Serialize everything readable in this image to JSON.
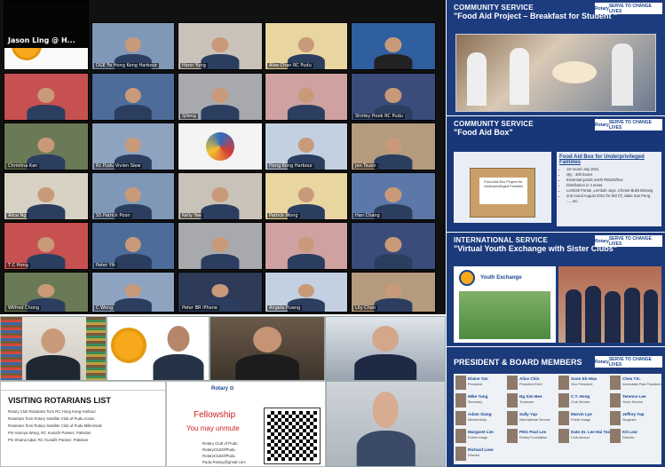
{
  "zoom_gallery": {
    "tiles": [
      {
        "name": "",
        "kind": "rotary"
      },
      {
        "name": "DGE Fe Hong Kong Harbour",
        "kind": "person"
      },
      {
        "name": "Hann Yung",
        "kind": "person"
      },
      {
        "name": "Aloe Chan RC Pudu",
        "kind": "person"
      },
      {
        "name": "",
        "kind": "slide"
      },
      {
        "name": "",
        "kind": "person"
      },
      {
        "name": "",
        "kind": "person"
      },
      {
        "name": "Sjfeng",
        "kind": "person"
      },
      {
        "name": "",
        "kind": "person"
      },
      {
        "name": "Shirley Hook RC Pudu",
        "kind": "person"
      },
      {
        "name": "Christina Kan",
        "kind": "person"
      },
      {
        "name": "Rc Pudu Vivien Siew",
        "kind": "person"
      },
      {
        "name": "",
        "kind": "logo"
      },
      {
        "name": "Hong Kong Harbour",
        "kind": "person"
      },
      {
        "name": "Jen Tsuen",
        "kind": "person"
      },
      {
        "name": "Alice Ng",
        "kind": "person"
      },
      {
        "name": "SS Patrick Poon",
        "kind": "person"
      },
      {
        "name": "Kelly Yee",
        "kind": "person"
      },
      {
        "name": "Patrick Wong",
        "kind": "person"
      },
      {
        "name": "Han Chang",
        "kind": "person"
      },
      {
        "name": "T C Hong",
        "kind": "person"
      },
      {
        "name": "Peter Yih",
        "kind": "person"
      },
      {
        "name": "",
        "kind": "person"
      },
      {
        "name": "",
        "kind": "person"
      },
      {
        "name": "",
        "kind": "person"
      },
      {
        "name": "Wilfred Chong",
        "kind": "person"
      },
      {
        "name": "C Wong",
        "kind": "person"
      },
      {
        "name": "Peter BR iPhone",
        "kind": "person"
      },
      {
        "name": "Angela Huang",
        "kind": "person"
      },
      {
        "name": "Lily Chan",
        "kind": "person"
      },
      {
        "name": "Jason Ling @ H...",
        "kind": "dark"
      }
    ]
  },
  "slides": {
    "community1": {
      "title1": "COMMUNITY SERVICE",
      "title2": "\"Food Aid Project – Breakfast for Student \""
    },
    "community2": {
      "title1": "COMMUNITY SERVICE",
      "title2": "\"Food Aid Box\"",
      "box_heading": "Food Aid Box for Underprivileged Families",
      "bullets": [
        "1st round July 2021",
        "Qty : 300 boxes",
        "Essential goods worth RM100/box",
        "Distribution in 4 areas",
        "Lembah Pantai ,Lembah Jaya ,Cheras Bukit Bintang",
        "2nd round August 2021 for SM (T) Jalan San Peng ......etc."
      ],
      "box_label": "Food Aid Box Project for Underprivileged Families"
    },
    "international": {
      "title1": "INTERNATIONAL SERVICE",
      "title2": "\"Virtual Youth Exchange with Sister Clubs\"",
      "youth": "Youth Exchange"
    },
    "board": {
      "title": "PRESIDENT & BOARD MEMBERS",
      "members": [
        {
          "name": "Elaine Tan",
          "role": "President"
        },
        {
          "name": "Alice Chin",
          "role": "President Elect"
        },
        {
          "name": "Soon Ek Hwa",
          "role": "Vice President"
        },
        {
          "name": "Chea T.K.",
          "role": "Immediate Past President"
        },
        {
          "name": "Mike Tung",
          "role": "Secretary"
        },
        {
          "name": "Ng Sim Bee",
          "role": "Treasurer"
        },
        {
          "name": "C.T. Hong",
          "role": "Club Service"
        },
        {
          "name": "Terence Lee",
          "role": "Youth Service"
        },
        {
          "name": "Adam Siang",
          "role": "Membership"
        },
        {
          "name": "Sally Yap",
          "role": "International Service"
        },
        {
          "name": "Marvin Lye",
          "role": "Public Image"
        },
        {
          "name": "Jeffrey Yap",
          "role": "Sergeant"
        },
        {
          "name": "Margaret Lim",
          "role": "Public Image"
        },
        {
          "name": "PDG Paul Lee",
          "role": "Rotary Foundation"
        },
        {
          "name": "Dato Dr. Lee Hai Tsong",
          "role": "Club Advisor"
        },
        {
          "name": "Kit Low",
          "role": "Director"
        },
        {
          "name": "Richard Liew",
          "role": "Director"
        }
      ]
    },
    "badge": {
      "left": "Rotary",
      "right": "SERVE TO CHANGE LIVES"
    }
  },
  "bottom_row": {
    "speaker_name": "",
    "visiting": {
      "title": "VISITING ROTARIANS LIST",
      "lines": [
        "Rotary Club Rotarians from RC Hong Kong Harbour",
        "Rotarians from Rotary Satellite Club of Pudu Action",
        "Rotarians from Rotary Satellite Club of Pudu Millennials",
        "Pin Hamrya Wong, RC Kuniafir Parwez, Pakistan",
        "Pin Shama Iqbal, RC Kuniafir Parwez, Pakistan"
      ]
    },
    "fellowship": {
      "title": "Fellowship",
      "subtitle": "You may unmute",
      "links": [
        "Rotary Club of Pudu",
        "RotaryClubOfPudu",
        "RotaryClubOfPudu",
        "Pudu.Rotary@gmail.com"
      ]
    }
  }
}
